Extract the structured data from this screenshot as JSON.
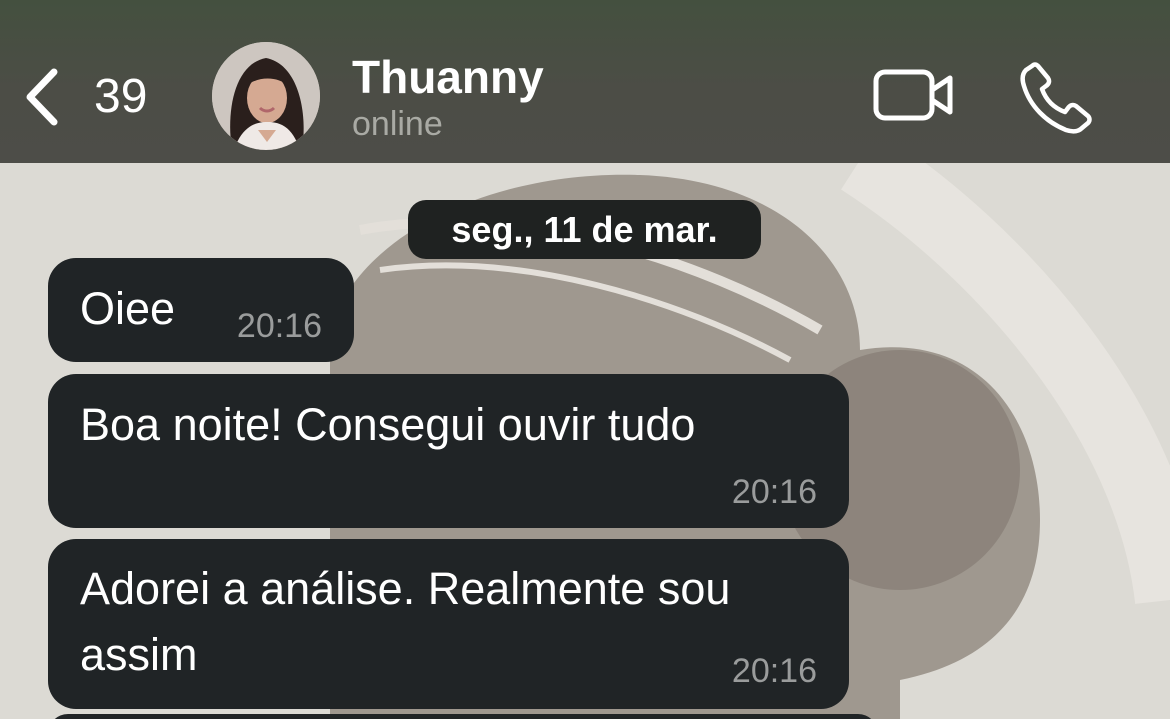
{
  "header": {
    "back_count": "39",
    "contact_name": "Thuanny",
    "contact_status": "online"
  },
  "icons": {
    "back": "chevron-left-icon",
    "video": "video-camera-icon",
    "call": "phone-icon"
  },
  "date_separator": "seg., 11 de mar.",
  "messages": [
    {
      "lines": [
        "Oiee"
      ],
      "time": "20:16"
    },
    {
      "lines": [
        "Boa noite! Consegui ouvir tudo"
      ],
      "time": "20:16"
    },
    {
      "lines": [
        "Adorei a análise. Realmente sou",
        "assim"
      ],
      "time": "20:16"
    }
  ],
  "colors": {
    "header_bg": "#4c4d46",
    "bubble_bg": "#202426",
    "date_chip_bg": "#1f2221",
    "status_text": "#a9aaa4",
    "timestamp_text": "#9a9c9c"
  }
}
